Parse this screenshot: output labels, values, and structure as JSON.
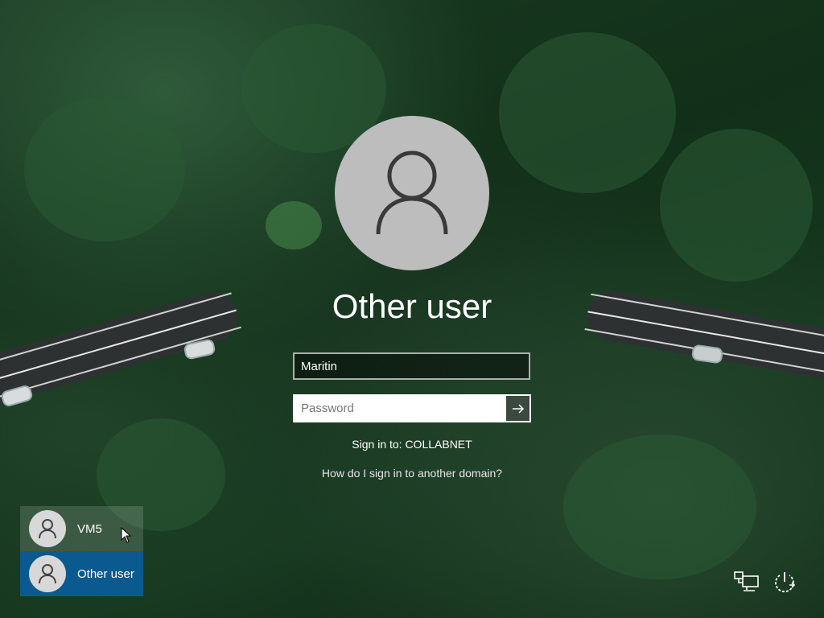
{
  "login": {
    "title": "Other user",
    "username_value": "Maritin",
    "password_placeholder": "Password",
    "sign_in_to": "Sign in to: COLLABNET",
    "domain_help_link": "How do I sign in to another domain?"
  },
  "users": [
    {
      "name": "VM5",
      "selected": false
    },
    {
      "name": "Other user",
      "selected": true
    }
  ],
  "icons": {
    "avatar": "user-silhouette-icon",
    "submit": "arrow-right-icon",
    "network": "network-icon",
    "power": "power-icon"
  },
  "colors": {
    "selected_user": "#0a5a8f",
    "avatar_bg": "#bdbdbd"
  }
}
